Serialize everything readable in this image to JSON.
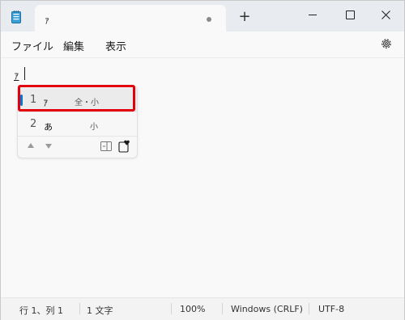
{
  "tab": {
    "title": "ｧ",
    "new_tab": "+"
  },
  "menu": {
    "items": [
      "ファイル",
      "編集",
      "表示"
    ]
  },
  "editor": {
    "typed_text": "ｧ"
  },
  "ime": {
    "candidates": [
      {
        "index": "1",
        "text": "ｧ",
        "note": "全・小"
      },
      {
        "index": "2",
        "text": "ぁ",
        "note": "小"
      }
    ]
  },
  "status": {
    "position": "行 1、列 1",
    "chars": "1 文字",
    "zoom": "100%",
    "line_ending": "Windows (CRLF)",
    "encoding": "UTF-8"
  },
  "colors": {
    "highlight": "#e0000e",
    "accent": "#0078d4"
  }
}
